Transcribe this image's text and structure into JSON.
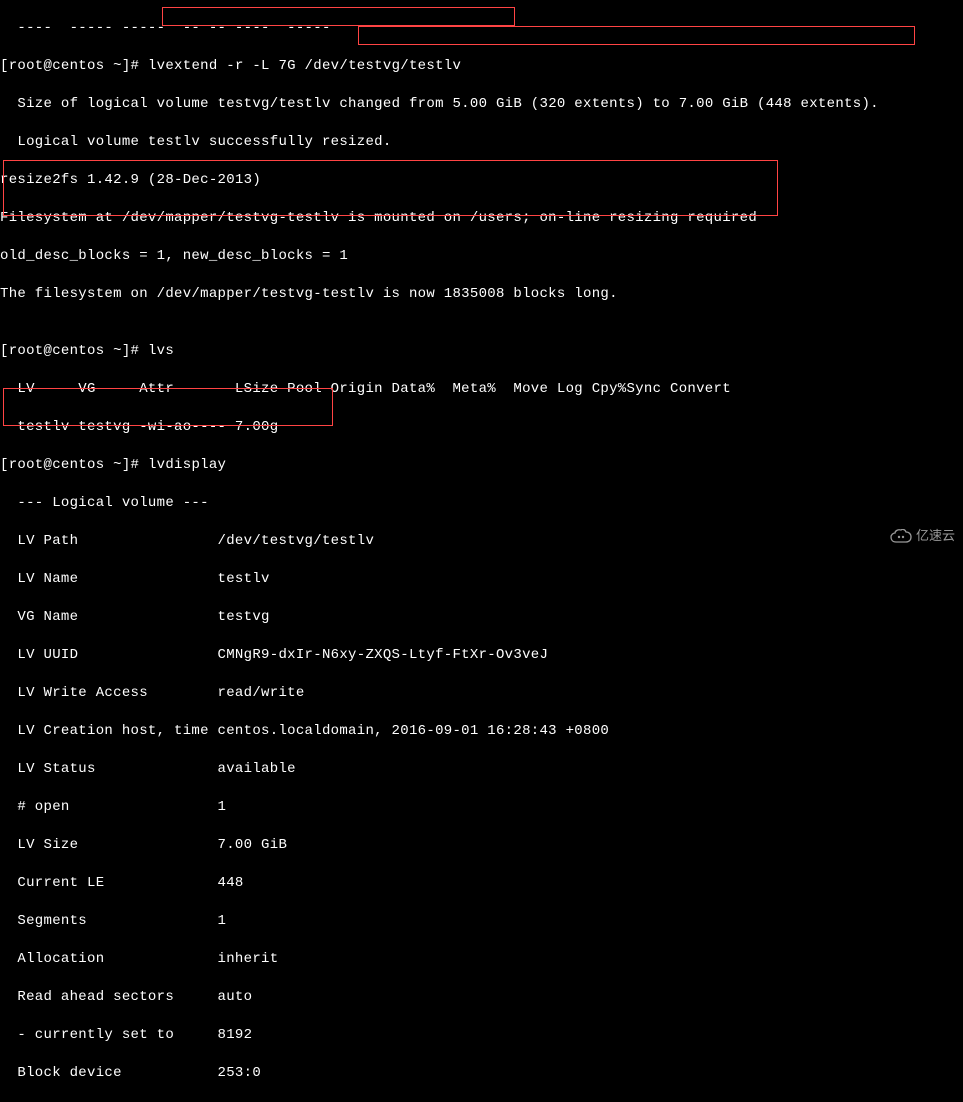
{
  "prompt_prefix": "[root@centos ~]# ",
  "commands": {
    "lvextend": "lvextend -r -L 7G /dev/testvg/testlv",
    "lvs": "lvs",
    "lvdisplay": "lvdisplay"
  },
  "output": {
    "truncated_top": "  ----  ----- -----  -- -- ----  -----",
    "size_change_prefix": "  Size of logical volume testvg/testlv ",
    "size_change_highlight": "changed from 5.00 GiB (320 extents) to 7.00 GiB (448 extents).",
    "resize_success": "  Logical volume testlv successfully resized.",
    "resize2fs": "resize2fs 1.42.9 (28-Dec-2013)",
    "fs_mounted": "Filesystem at /dev/mapper/testvg-testlv is mounted on /users; on-line resizing required",
    "desc_blocks": "old_desc_blocks = 1, new_desc_blocks = 1",
    "fs_now": "The filesystem on /dev/mapper/testvg-testlv is now 1835008 blocks long.",
    "blank": "",
    "lvs_header": "  LV     VG     Attr       LSize Pool Origin Data%  Meta%  Move Log Cpy%Sync Convert",
    "lvs_row": "  testlv testvg -wi-ao---- 7.00g",
    "lvdisplay": {
      "header": "  --- Logical volume ---",
      "path": "  LV Path                /dev/testvg/testlv",
      "name": "  LV Name                testlv",
      "vgname": "  VG Name                testvg",
      "uuid": "  LV UUID                CMNgR9-dxIr-N6xy-ZXQS-Ltyf-FtXr-Ov3veJ",
      "access": "  LV Write Access        read/write",
      "creation": "  LV Creation host, time centos.localdomain, 2016-09-01 16:28:43 +0800",
      "status": "  LV Status              available",
      "open": "  # open                 1",
      "size": "  LV Size                7.00 GiB",
      "currentle": "  Current LE             448",
      "segments": "  Segments               1",
      "allocation": "  Allocation             inherit",
      "readahead": "  Read ahead sectors     auto",
      "currently": "  - currently set to     8192",
      "blockdev": "  Block device           253:0"
    }
  },
  "watermark": {
    "text": "亿速云"
  }
}
